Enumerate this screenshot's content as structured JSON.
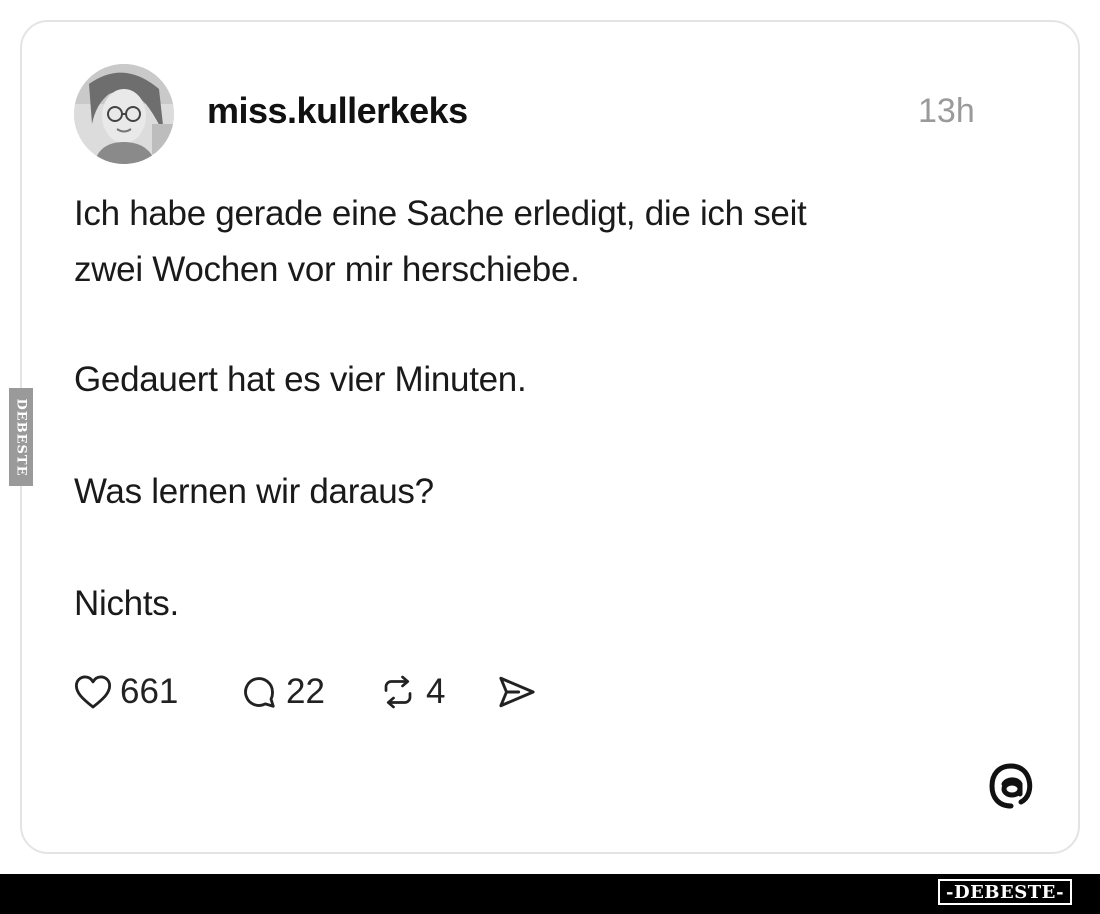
{
  "post": {
    "username": "miss.kullerkeks",
    "timestamp": "13h",
    "paragraphs": {
      "p1_line1": "Ich habe gerade eine Sache erledigt, die ich seit",
      "p1_line2": "zwei Wochen vor mir herschiebe.",
      "p2": "Gedauert hat es vier Minuten.",
      "p3": "Was lernen wir daraus?",
      "p4": "Nichts."
    },
    "actions": {
      "likes": "661",
      "replies": "22",
      "reposts": "4"
    },
    "icons": {
      "like": "heart-icon",
      "reply": "speech-bubble-icon",
      "repost": "repost-arrows-icon",
      "share": "send-icon",
      "brand": "threads-logo-icon"
    }
  },
  "watermark": {
    "side": "DEBESTE",
    "bottom": "-DEBESTE-"
  },
  "colors": {
    "text": "#1a1a1a",
    "muted": "#9a9a9a",
    "card_border": "#e4e4e4",
    "bottom_bar": "#000000"
  }
}
